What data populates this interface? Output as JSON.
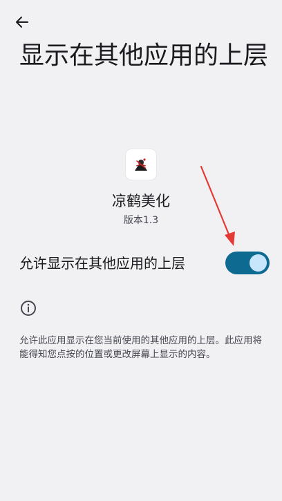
{
  "header": {
    "back_icon": "arrow-left-icon",
    "title": "显示在其他应用的上层"
  },
  "app": {
    "icon": "app-logo-icon",
    "name": "凉鹤美化",
    "version": "版本1.3"
  },
  "permission": {
    "label": "允许显示在其他应用的上层",
    "enabled": true
  },
  "info": {
    "icon": "info-icon",
    "description": "允许此应用显示在您当前使用的其他应用的上层。此应用将能得知您点按的位置或更改屏幕上显示的内容。"
  },
  "annotation": {
    "icon": "red-arrow-annotation",
    "color": "#e53935"
  },
  "colors": {
    "background": "#f1f1f4",
    "switch_track": "#0f6a92",
    "switch_thumb": "#c8e6fb"
  }
}
